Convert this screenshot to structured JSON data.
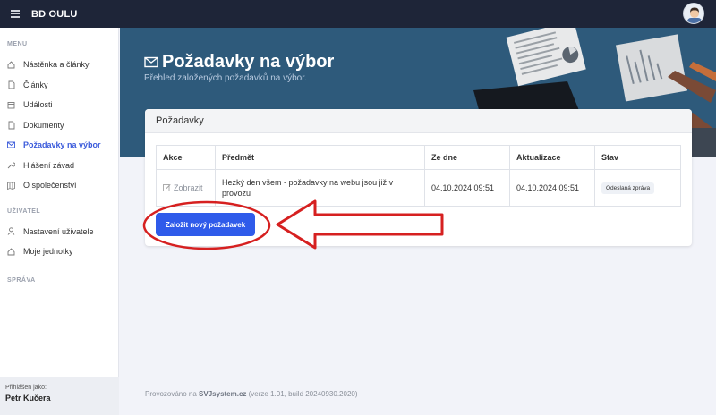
{
  "topbar": {
    "brand": "BD OULU",
    "avatar": "avatar"
  },
  "sidebar": {
    "sections": [
      {
        "label": "MENU",
        "items": [
          {
            "label": "Nástěnka a články",
            "icon": "home-icon"
          },
          {
            "label": "Články",
            "icon": "file-icon"
          },
          {
            "label": "Události",
            "icon": "calendar-icon"
          },
          {
            "label": "Dokumenty",
            "icon": "document-icon"
          },
          {
            "label": "Požadavky na výbor",
            "icon": "mail-icon",
            "active": true
          },
          {
            "label": "Hlášení závad",
            "icon": "wrench-icon"
          },
          {
            "label": "O společenství",
            "icon": "map-icon"
          }
        ]
      },
      {
        "label": "UŽIVATEL",
        "items": [
          {
            "label": "Nastavení uživatele",
            "icon": "user-icon"
          },
          {
            "label": "Moje jednotky",
            "icon": "home-icon"
          }
        ]
      },
      {
        "label": "SPRÁVA",
        "items": []
      }
    ],
    "footer": {
      "logged_as": "Přihlášen jako:",
      "user": "Petr Kučera"
    }
  },
  "hero": {
    "title": "Požadavky na výbor",
    "subtitle": "Přehled založených požadavků na výbor."
  },
  "card": {
    "title": "Požadavky",
    "columns": [
      "Akce",
      "Předmět",
      "Ze dne",
      "Aktualizace",
      "Stav"
    ],
    "rows": [
      {
        "action": "Zobrazit",
        "subject": "Hezký den všem - požadavky na webu jsou již v provozu",
        "created": "04.10.2024 09:51",
        "updated": "04.10.2024 09:51",
        "status": "Odeslaná zpráva"
      }
    ],
    "new_button": "Založit nový požadavek"
  },
  "footer": {
    "prefix": "Provozováno na ",
    "site": "SVJsystem.cz",
    "suffix": " (verze 1.01, build 20240930.2020)"
  },
  "colors": {
    "accent": "#2f5bea",
    "annotation": "#d62020",
    "hero": "#2e5a7b",
    "topbar": "#1e2538"
  }
}
